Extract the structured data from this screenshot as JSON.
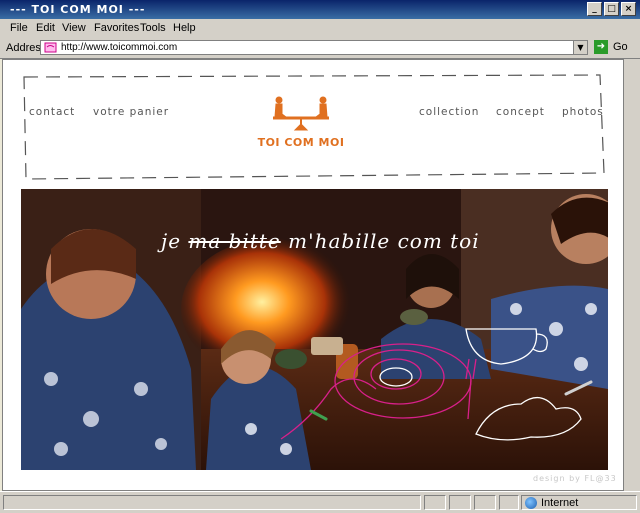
{
  "window": {
    "title": "--- TOI COM MOI ---",
    "controls": [
      "minimize",
      "maximize",
      "close"
    ]
  },
  "menu": [
    "File",
    "Edit",
    "View",
    "Favorites",
    "Tools",
    "Help"
  ],
  "address": {
    "label": "Address",
    "url": "http://www.toicommoi.com",
    "go_label": "Go"
  },
  "site": {
    "nav_left": [
      "contact",
      "votre panier"
    ],
    "nav_right": [
      "collection",
      "concept",
      "photos"
    ],
    "logo_text": "TOI COM MOI",
    "tagline_struck": "ma bitte",
    "tagline_prefix": "je",
    "tagline_rest": "m'habille com toi",
    "credit": "design by FL@33"
  },
  "status": {
    "zone": "Internet"
  },
  "colors": {
    "accent": "#e07020",
    "titlebar": "#0a246a"
  }
}
